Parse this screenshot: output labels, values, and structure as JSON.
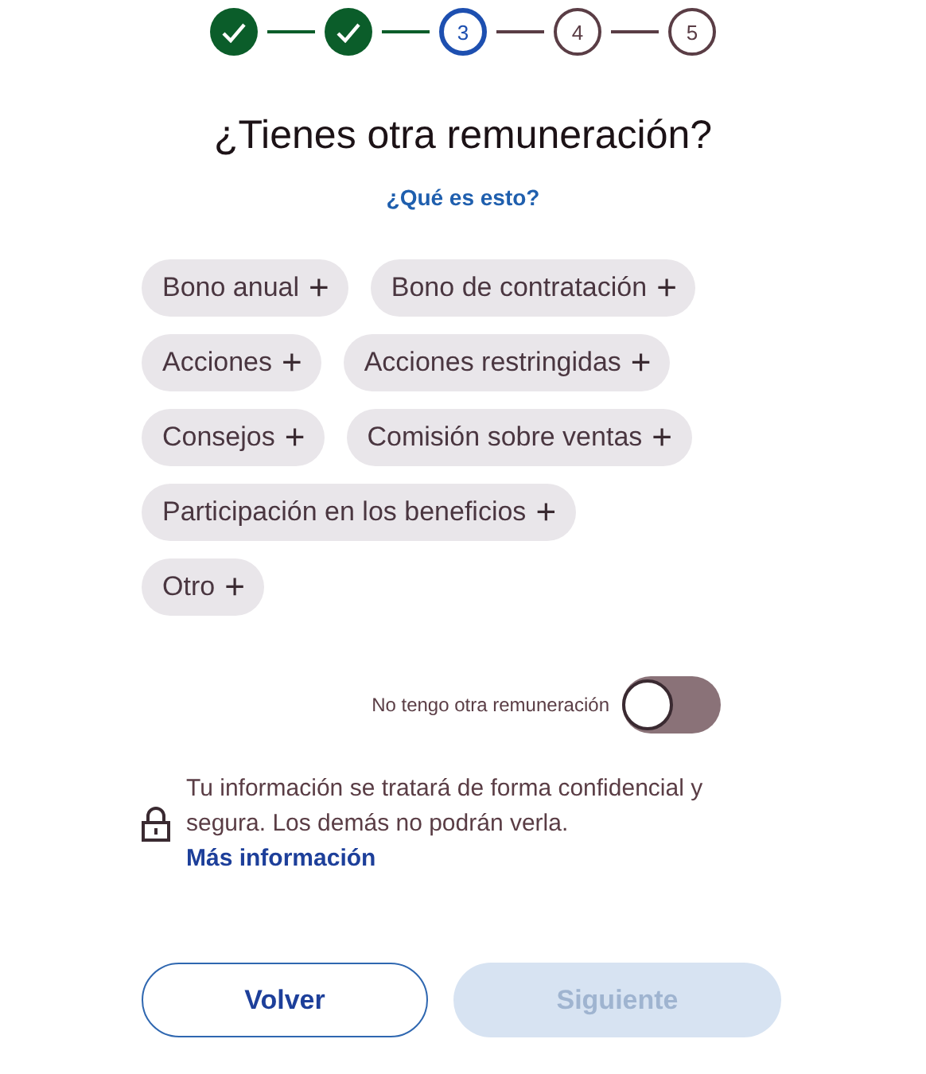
{
  "steps": [
    {
      "completed": true,
      "current": false
    },
    {
      "completed": true,
      "current": false
    },
    {
      "completed": false,
      "current": true,
      "label": "3"
    },
    {
      "completed": false,
      "current": false,
      "label": "4"
    },
    {
      "completed": false,
      "current": false,
      "label": "5"
    }
  ],
  "title": "¿Tienes otra remuneración?",
  "help_link": "¿Qué es esto?",
  "chip_rows": [
    [
      {
        "label": "Bono anual",
        "icon": "+"
      },
      {
        "label": "Bono de contratación",
        "icon": "+"
      }
    ],
    [
      {
        "label": "Acciones",
        "icon": "+"
      },
      {
        "label": "Acciones restringidas",
        "icon": "+"
      }
    ],
    [
      {
        "label": "Consejos",
        "icon": "+"
      },
      {
        "label": "Comisión sobre ventas",
        "icon": "+"
      }
    ],
    [
      {
        "label": "Participación en los beneficios",
        "icon": "+"
      }
    ],
    [
      {
        "label": "Otro",
        "icon": "+"
      }
    ]
  ],
  "toggle": {
    "label": "No tengo otra remuneración",
    "on": false
  },
  "privacy": {
    "text": "Tu información se tratará de forma confidencial y segura. Los demás no podrán verla.",
    "link": "Más información"
  },
  "buttons": [
    {
      "label": "Volver",
      "kind": "secondary",
      "disabled": false
    },
    {
      "label": "Siguiente",
      "kind": "primary",
      "disabled": true
    }
  ]
}
